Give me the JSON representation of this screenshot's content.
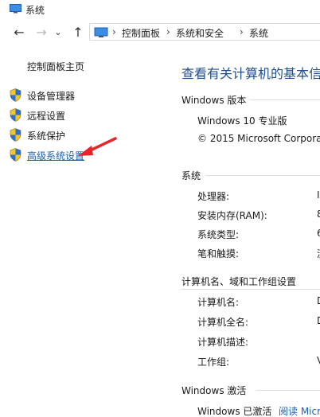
{
  "window": {
    "title": "系统"
  },
  "nav": {
    "back_glyph": "←",
    "forward_glyph": "→",
    "recent_glyph": "⌄",
    "up_glyph": "↑",
    "breadcrumbs": [
      "控制面板",
      "系统和安全",
      "系统"
    ],
    "separator": "›"
  },
  "sidebar": {
    "home": "控制面板主页",
    "items": [
      {
        "label": "设备管理器",
        "icon": "shield-icon"
      },
      {
        "label": "远程设置",
        "icon": "shield-icon"
      },
      {
        "label": "系统保护",
        "icon": "shield-icon"
      },
      {
        "label": "高级系统设置",
        "icon": "shield-icon",
        "active": true
      }
    ]
  },
  "main": {
    "title": "查看有关计算机的基本信",
    "edition_section": "Windows 版本",
    "edition": "Windows 10 专业版",
    "copyright": "© 2015 Microsoft Corpora",
    "system_section": "系统",
    "system_rows": [
      {
        "label": "处理器:",
        "value": "I"
      },
      {
        "label": "安装内存(RAM):",
        "value": "8"
      },
      {
        "label": "系统类型:",
        "value": "6"
      },
      {
        "label": "笔和触摸:",
        "value": "没"
      }
    ],
    "computer_section": "计算机名、域和工作组设置",
    "computer_rows": [
      {
        "label": "计算机名:",
        "value": "D"
      },
      {
        "label": "计算机全名:",
        "value": "D"
      },
      {
        "label": "计算机描述:",
        "value": ""
      },
      {
        "label": "工作组:",
        "value": "V"
      }
    ],
    "activation_section": "Windows 激活",
    "activation_status": "Windows 已激活",
    "activation_link": "阅读 Micr"
  },
  "colors": {
    "link": "#1a5fb4",
    "title": "#1e4e8c",
    "annotation_arrow": "#e8232a"
  }
}
